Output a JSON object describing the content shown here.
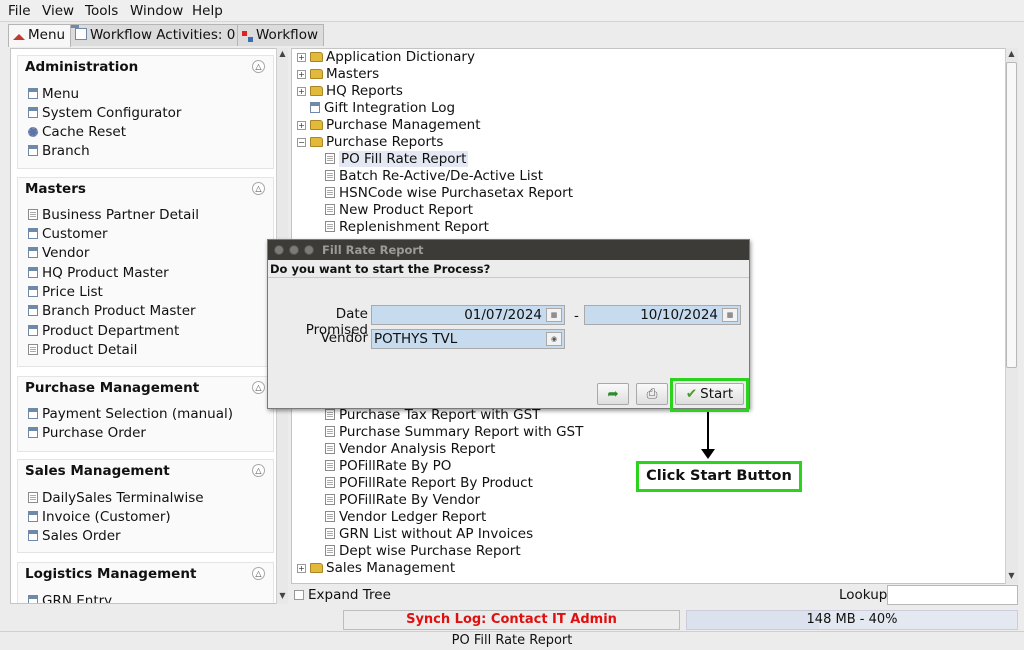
{
  "menubar": [
    "File",
    "View",
    "Tools",
    "Window",
    "Help"
  ],
  "tabs": {
    "menu": "Menu",
    "workflow_activities": "Workflow Activities: 0",
    "workflow": "Workflow"
  },
  "left_panel": {
    "groups": [
      {
        "title": "Administration",
        "items": [
          {
            "label": "Menu",
            "icon": "window-icon"
          },
          {
            "label": "System Configurator",
            "icon": "window-icon"
          },
          {
            "label": "Cache Reset",
            "icon": "gear-icon"
          },
          {
            "label": "Branch",
            "icon": "window-icon"
          }
        ]
      },
      {
        "title": "Masters",
        "items": [
          {
            "label": "Business Partner Detail",
            "icon": "report-icon"
          },
          {
            "label": "Customer",
            "icon": "window-icon"
          },
          {
            "label": "Vendor",
            "icon": "window-icon"
          },
          {
            "label": "HQ Product Master",
            "icon": "window-icon"
          },
          {
            "label": "Price List",
            "icon": "window-icon"
          },
          {
            "label": "Branch Product Master",
            "icon": "window-icon"
          },
          {
            "label": "Product Department",
            "icon": "window-icon"
          },
          {
            "label": "Product Detail",
            "icon": "report-icon"
          }
        ]
      },
      {
        "title": "Purchase Management",
        "items": [
          {
            "label": "Payment Selection (manual)",
            "icon": "window-icon"
          },
          {
            "label": "Purchase Order",
            "icon": "window-icon"
          }
        ]
      },
      {
        "title": "Sales Management",
        "items": [
          {
            "label": "DailySales Terminalwise",
            "icon": "report-icon"
          },
          {
            "label": "Invoice (Customer)",
            "icon": "window-icon"
          },
          {
            "label": "Sales Order",
            "icon": "window-icon"
          }
        ]
      },
      {
        "title": "Logistics Management",
        "items": [
          {
            "label": "GRN Entry",
            "icon": "window-icon"
          }
        ]
      }
    ]
  },
  "tree": {
    "folders_top": [
      "Application Dictionary",
      "Masters",
      "HQ Reports"
    ],
    "gift": "Gift Integration Log",
    "purchase_management": "Purchase Management",
    "purchase_reports": "Purchase Reports",
    "reports_top": [
      "PO Fill Rate Report",
      "Batch Re-Active/De-Active List",
      "HSNCode wise Purchasetax Report",
      "New Product Report",
      "Replenishment Report"
    ],
    "reports_bottom": [
      "Purchase Tax Report with GST",
      "Purchase Summary Report with GST",
      "Vendor Analysis Report",
      "POFillRate By PO",
      "POFillRate Report By Product",
      "POFillRate By Vendor",
      "Vendor Ledger Report",
      "GRN List without AP Invoices",
      "Dept wise Purchase Report"
    ],
    "sales_management": "Sales Management",
    "expand_tree": "Expand Tree",
    "lookup": "Lookup"
  },
  "dialog": {
    "title": "Fill Rate Report",
    "message": "Do you want to start the Process?",
    "date_promised_label": "Date Promised",
    "date_from": "01/07/2024",
    "date_separator": "-",
    "date_to": "10/10/2024",
    "vendor_label": "Vendor",
    "vendor_value": "POTHYS TVL",
    "start_label": "Start"
  },
  "annotation": {
    "callout": "Click Start Button",
    "highlight_color": "#2ad31c"
  },
  "status": {
    "synch_log": "Synch Log: Contact IT Admin",
    "memory": "148 MB - 40%",
    "memory_used_fraction": 0.4,
    "status_text": "PO Fill Rate Report"
  }
}
